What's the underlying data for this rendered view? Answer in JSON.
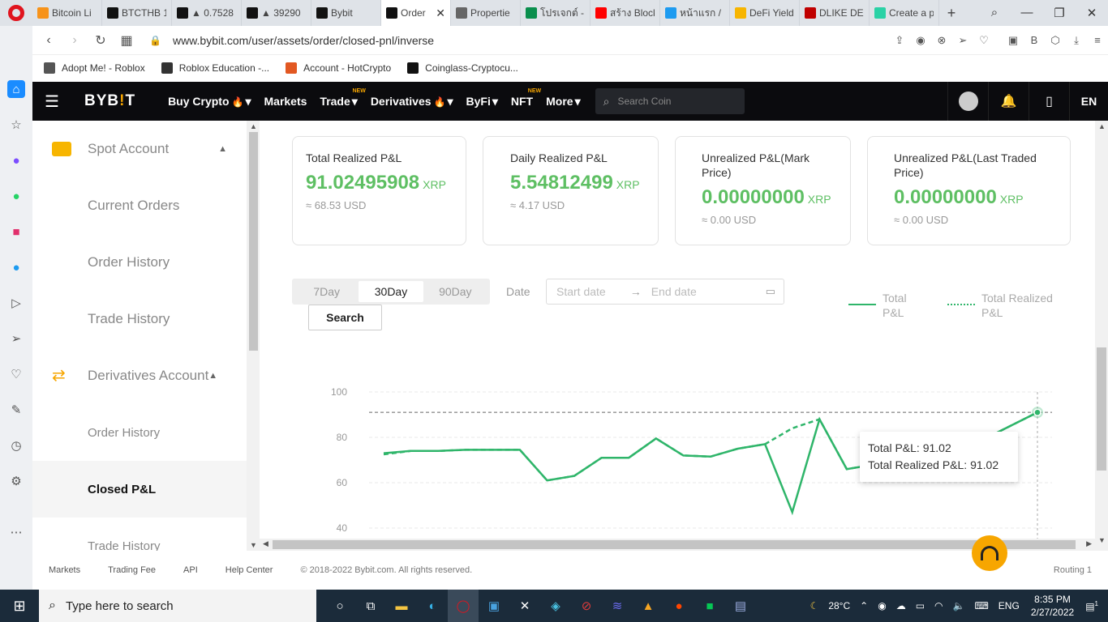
{
  "browser": {
    "tabs": [
      {
        "label": "Bitcoin Li",
        "color": "#f7931a",
        "icon": "bitcoin-icon"
      },
      {
        "label": "BTCTHB 1",
        "color": "#111111",
        "icon": "bybit-icon"
      },
      {
        "label": "▲ 0.7528",
        "color": "#111111",
        "icon": "bybit-icon"
      },
      {
        "label": "▲ 39290",
        "color": "#111111",
        "icon": "bybit-icon"
      },
      {
        "label": "Bybit",
        "color": "#111111",
        "icon": "bybit-icon"
      },
      {
        "label": "Order",
        "color": "#111111",
        "icon": "bybit-icon",
        "active": true
      },
      {
        "label": "Propertie",
        "color": "#666666",
        "icon": "globe-icon"
      },
      {
        "label": "โปรเจกต์ -",
        "color": "#0a8f4d",
        "icon": "sheet-icon"
      },
      {
        "label": "สร้าง Block",
        "color": "#ff0000",
        "icon": "youtube-icon"
      },
      {
        "label": "หน้าแรก /",
        "color": "#1d9bf0",
        "icon": "twitter-icon"
      },
      {
        "label": "DeFi Yield",
        "color": "#f7b500",
        "icon": "heart-icon"
      },
      {
        "label": "DLIKE DE",
        "color": "#c00000",
        "icon": "heart-icon"
      },
      {
        "label": "Create a p",
        "color": "#2bd2a6",
        "icon": "circle-icon"
      }
    ],
    "url": "www.bybit.com/user/assets/order/closed-pnl/inverse",
    "bookmarks": [
      "Adopt Me! - Roblox",
      "Roblox Education -...",
      "Account - HotCrypto",
      "Coinglass-Cryptocu..."
    ]
  },
  "nav": {
    "logo_a": "BYB",
    "logo_b": "!",
    "logo_c": "T",
    "items": [
      {
        "label": "Buy Crypto",
        "fire": "🔥",
        "caret": "▾"
      },
      {
        "label": "Markets"
      },
      {
        "label": "Trade",
        "badge": "NEW",
        "caret": "▾"
      },
      {
        "label": "Derivatives",
        "fire": "🔥",
        "caret": "▾"
      },
      {
        "label": "ByFi",
        "caret": "▾"
      },
      {
        "label": "NFT",
        "badge": "NEW"
      },
      {
        "label": "More",
        "caret": "▾"
      }
    ],
    "search_placeholder": "Search Coin",
    "lang": "EN"
  },
  "left_menu": {
    "spot_group": "Spot Account",
    "spot_items": [
      "Current Orders",
      "Order History",
      "Trade History"
    ],
    "deriv_group": "Derivatives Account",
    "deriv_items": [
      "Order History",
      "Closed P&L",
      "Trade History"
    ]
  },
  "cards": [
    {
      "title": "Total Realized P&L",
      "value": "91.02495908",
      "unit": "XRP",
      "usd": "≈ 68.53 USD"
    },
    {
      "title": "Daily Realized P&L",
      "value": "5.54812499",
      "unit": "XRP",
      "usd": "≈ 4.17 USD"
    },
    {
      "title": "Unrealized P&L(Mark Price)",
      "value": "0.00000000",
      "unit": "XRP",
      "usd": "≈ 0.00 USD"
    },
    {
      "title": "Unrealized P&L(Last Traded Price)",
      "value": "0.00000000",
      "unit": "XRP",
      "usd": "≈ 0.00 USD"
    }
  ],
  "filters": {
    "periods": [
      "7Day",
      "30Day",
      "90Day"
    ],
    "active_period": "30Day",
    "date_label": "Date",
    "start_placeholder": "Start date",
    "arrow": "→",
    "end_placeholder": "End date",
    "search_label": "Search"
  },
  "legend": {
    "total": "Total P&L",
    "total_realized": "Total Realized P&L"
  },
  "tooltip": {
    "line1_label": "Total P&L:",
    "line1_value": "91.02",
    "line2_label": "Total Realized P&L:",
    "line2_value": "91.02"
  },
  "chart_data": {
    "type": "line",
    "yticks": [
      100,
      80,
      60,
      40
    ],
    "ylim": [
      40,
      100
    ],
    "reference_line": 91.02,
    "series": [
      {
        "name": "Total P&L",
        "style": "solid",
        "values": [
          73,
          74,
          74,
          74.5,
          74.5,
          74.5,
          61,
          63,
          71,
          71,
          79.5,
          72,
          71.5,
          75,
          77,
          47,
          88,
          66,
          68,
          70,
          73,
          76,
          79,
          85,
          91
        ]
      },
      {
        "name": "Total Realized P&L",
        "style": "dotted",
        "values": [
          72.5,
          74,
          74,
          74.5,
          74.5,
          74.5,
          61,
          63,
          71,
          71,
          79.5,
          72,
          71.5,
          75,
          77,
          84,
          88,
          66,
          68,
          70,
          73,
          76,
          79,
          85,
          91
        ]
      }
    ],
    "color": "#2fb56a"
  },
  "footer": {
    "links": [
      "Markets",
      "Trading Fee",
      "API",
      "Help Center"
    ],
    "copyright": "© 2018-2022 Bybit.com. All rights reserved.",
    "routing": "Routing 1"
  },
  "taskbar": {
    "search_placeholder": "Type here to search",
    "temp": "28°C",
    "lang": "ENG",
    "time": "8:35 PM",
    "date": "2/27/2022",
    "notifications": "1"
  }
}
